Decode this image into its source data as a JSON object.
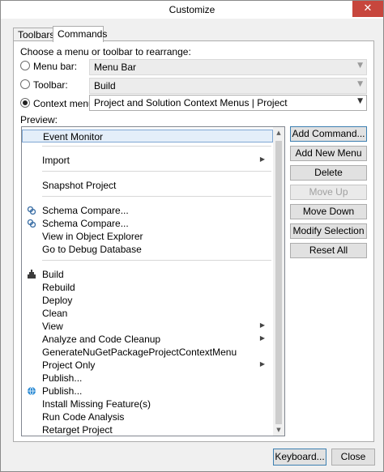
{
  "window": {
    "title": "Customize",
    "close_glyph": "✕"
  },
  "tabs": [
    {
      "label": "Toolbars",
      "active": false
    },
    {
      "label": "Commands",
      "active": true
    }
  ],
  "choose_label": "Choose a menu or toolbar to rearrange:",
  "options": [
    {
      "label": "Menu bar:",
      "value": "Menu Bar",
      "selected": false
    },
    {
      "label": "Toolbar:",
      "value": "Build",
      "selected": false
    },
    {
      "label": "Context menu:",
      "value": "Project and Solution Context Menus | Project",
      "selected": true
    }
  ],
  "dropdown_arrow": "▼",
  "preview_label": "Preview:",
  "preview_items": [
    {
      "label": "Event Monitor",
      "selected": true
    },
    {
      "label": "Import",
      "submenu": true
    },
    {
      "label": "Snapshot Project"
    },
    {
      "label": "Schema Compare...",
      "icon": "schema-compare-icon"
    },
    {
      "label": "Schema Compare...",
      "icon": "schema-compare-icon"
    },
    {
      "label": "View in Object Explorer"
    },
    {
      "label": "Go to Debug Database"
    },
    {
      "label": "Build",
      "icon": "build-icon"
    },
    {
      "label": "Rebuild"
    },
    {
      "label": "Deploy"
    },
    {
      "label": "Clean"
    },
    {
      "label": "View",
      "submenu": true
    },
    {
      "label": "Analyze and Code Cleanup",
      "submenu": true
    },
    {
      "label": "GenerateNuGetPackageProjectContextMenu"
    },
    {
      "label": "Project Only",
      "submenu": true
    },
    {
      "label": "Publish..."
    },
    {
      "label": "Publish...",
      "icon": "globe-icon"
    },
    {
      "label": "Install Missing Feature(s)"
    },
    {
      "label": "Run Code Analysis"
    },
    {
      "label": "Retarget Project"
    }
  ],
  "submenu_glyph": "▶",
  "scroll": {
    "up": "▲",
    "down": "▼"
  },
  "buttons": [
    {
      "label": "Add Command...",
      "enabled": true
    },
    {
      "label": "Add New Menu",
      "enabled": true
    },
    {
      "label": "Delete",
      "enabled": true
    },
    {
      "label": "Move Up",
      "enabled": false
    },
    {
      "label": "Move Down",
      "enabled": true
    },
    {
      "label": "Modify Selection",
      "enabled": true
    },
    {
      "label": "Reset All",
      "enabled": true
    }
  ],
  "footer": {
    "keyboard_label": "Keyboard...",
    "close_label": "Close"
  },
  "colors": {
    "close_button": "#c7463d",
    "selection_fill": "#e4eef9",
    "selection_border": "#7fa7d4"
  }
}
